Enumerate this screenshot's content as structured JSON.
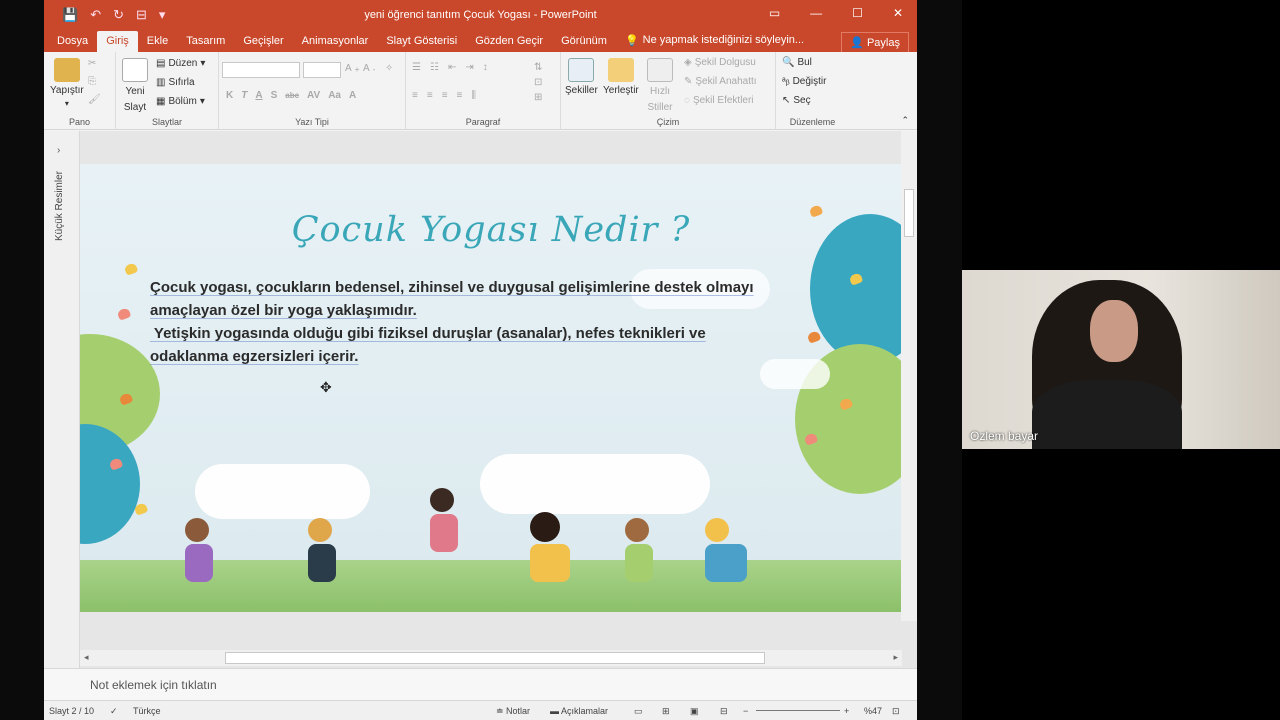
{
  "window": {
    "title": "yeni öğrenci tanıtım Çocuk Yogası - PowerPoint",
    "controls": [
      "▭",
      "—",
      "☐",
      "✕"
    ]
  },
  "quick_access": [
    "💾",
    "↶",
    "↻",
    "⊟",
    "▾"
  ],
  "tabs": [
    {
      "label": "Dosya"
    },
    {
      "label": "Giriş",
      "active": true
    },
    {
      "label": "Ekle"
    },
    {
      "label": "Tasarım"
    },
    {
      "label": "Geçişler"
    },
    {
      "label": "Animasyonlar"
    },
    {
      "label": "Slayt Gösterisi"
    },
    {
      "label": "Gözden Geçir"
    },
    {
      "label": "Görünüm"
    }
  ],
  "tell_me": "Ne yapmak istediğinizi söyleyin...",
  "share": "Paylaş",
  "ribbon": {
    "pano": {
      "label": "Pano",
      "paste": "Yapıştır"
    },
    "slaytlar": {
      "label": "Slaytlar",
      "new_slide": "Yeni",
      "new_slide2": "Slayt",
      "layout": "Düzen",
      "reset": "Sıfırla",
      "section": "Bölüm"
    },
    "yazi_tipi": {
      "label": "Yazı Tipi",
      "format_buttons": [
        "K",
        "T",
        "A",
        "S",
        "abc",
        "AV",
        "Aa",
        "A"
      ]
    },
    "paragraf": {
      "label": "Paragraf"
    },
    "cizim": {
      "label": "Çizim",
      "shapes": "Şekiller",
      "arrange": "Yerleştir",
      "quick_styles": "Hızlı",
      "quick_styles2": "Stiller",
      "fill": "Şekil Dolgusu",
      "outline": "Şekil Anahattı",
      "effects": "Şekil Efektleri"
    },
    "duzenleme": {
      "label": "Düzenleme",
      "find": "Bul",
      "replace": "Değiştir",
      "select": "Seç"
    }
  },
  "thumbnail_pane_label": "Küçük Resimler",
  "slide": {
    "title": "Çocuk Yogası Nedir ?",
    "body_lines": [
      "Çocuk yogası, çocukların bedensel, zihinsel ve duygusal gelişimlerine destek olmayı",
      "amaçlayan özel bir yoga yaklaşımıdır.",
      " Yetişkin yogasında olduğu gibi fiziksel duruşlar (asanalar), nefes teknikleri ve",
      "odaklanma egzersizleri içerir."
    ]
  },
  "notes_placeholder": "Not eklemek için tıklatın",
  "status": {
    "slide_counter": "Slayt 2 / 10",
    "language": "Türkçe",
    "notes": "Notlar",
    "comments": "Açıklamalar",
    "zoom": "%47"
  },
  "webcam": {
    "name": "Ozlem bayar"
  },
  "colors": {
    "accent": "#c9472b",
    "title_teal": "#3aa7b8"
  }
}
